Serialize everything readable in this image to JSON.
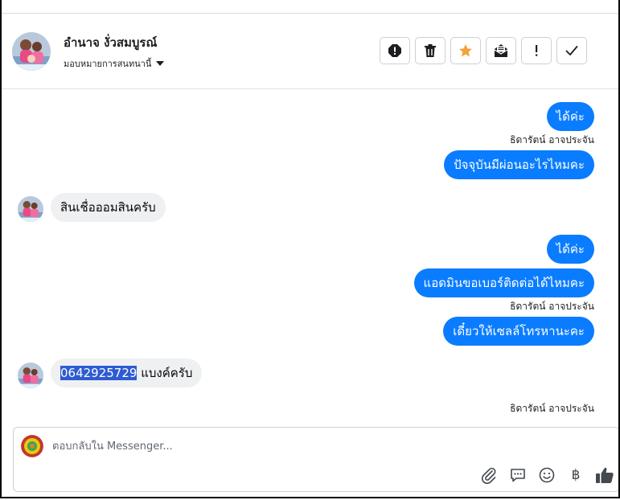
{
  "contact": {
    "name": "อำนาจ งั่วสมบูรณ์",
    "assign_label": "มอบหมายการสนทนานี้"
  },
  "header_actions": [
    {
      "name": "spam",
      "icon": "alert-circle-icon"
    },
    {
      "name": "delete",
      "icon": "trash-icon"
    },
    {
      "name": "star",
      "icon": "star-icon",
      "color": "#f2a33a"
    },
    {
      "name": "mark-unread",
      "icon": "envelope-open-icon"
    },
    {
      "name": "follow-up",
      "icon": "exclamation-icon"
    },
    {
      "name": "done",
      "icon": "check-icon"
    }
  ],
  "messages": [
    {
      "direction": "outgoing",
      "text": "ได้ค่ะ"
    },
    {
      "direction": "sender",
      "text": "ธิดารัตน์ อาจประจัน"
    },
    {
      "direction": "outgoing",
      "text": "ปัจจุบันมีผ่อนอะไรไหมคะ"
    },
    {
      "direction": "incoming",
      "text": "สินเชื่อออมสินครับ"
    },
    {
      "direction": "outgoing",
      "text": "ได้ค่ะ"
    },
    {
      "direction": "outgoing",
      "text": "แอดมินขอเบอร์ติดต่อได้ไหมคะ"
    },
    {
      "direction": "sender",
      "text": "ธิดารัตน์ อาจประจัน"
    },
    {
      "direction": "outgoing",
      "text": "เดี๋ยวให้เซลล์โทรหานะคะ"
    },
    {
      "direction": "incoming",
      "text_highlight": "0642925729",
      "text_rest": " แบงค์ครับ"
    },
    {
      "direction": "sender",
      "text": "ธิดารัตน์ อาจประจัน"
    }
  ],
  "composer": {
    "placeholder": "ตอบกลับใน Messenger...",
    "tools": [
      "paperclip-icon",
      "speech-bubble-icon",
      "smiley-icon",
      "baht-icon",
      "thumbs-up-icon"
    ],
    "baht_symbol": "฿"
  },
  "colors": {
    "outgoing_bubble": "#0a7cff",
    "incoming_bubble": "#eff0f2",
    "highlight": "#2e5bd1",
    "star": "#f2a33a"
  }
}
